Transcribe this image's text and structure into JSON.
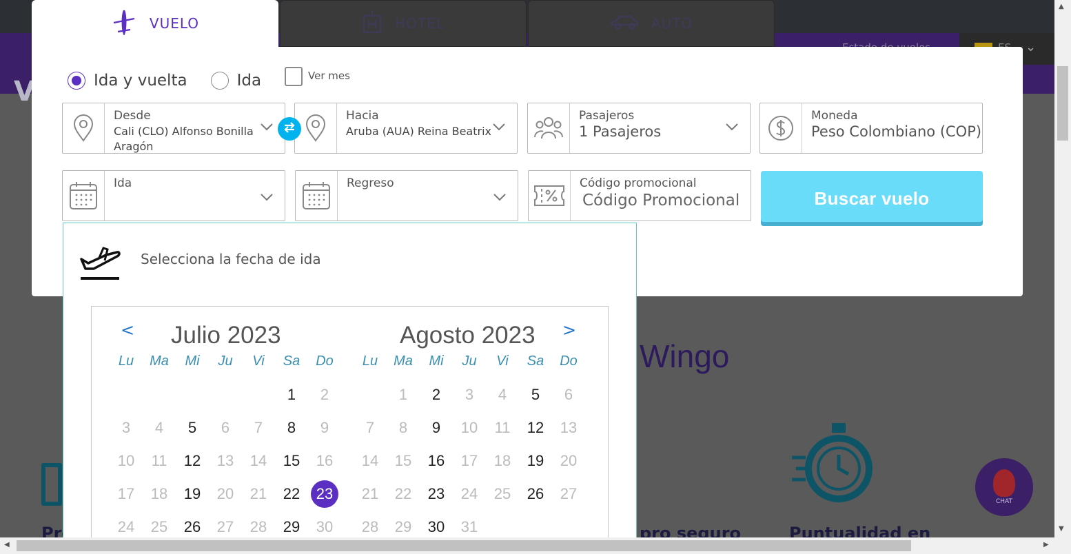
{
  "background": {
    "flight_status": "Estado de vuelos",
    "language": "ES",
    "brand_text": "Wingo",
    "logo_fragment": "V",
    "heading_left": "Pre",
    "heading_mid": "pro seguro",
    "heading_right": "Puntualidad en"
  },
  "tabs": [
    {
      "label": "VUELO",
      "icon": "plane-icon",
      "active": true
    },
    {
      "label": "HOTEL",
      "icon": "hotel-icon",
      "active": false
    },
    {
      "label": "AUTO",
      "icon": "car-icon",
      "active": false
    }
  ],
  "trip_type": {
    "round_trip": "Ida y vuelta",
    "one_way": "Ida",
    "selected": "round_trip",
    "view_month": "Ver mes"
  },
  "search": {
    "from_label": "Desde",
    "from_value_line1": "Cali (CLO) Alfonso Bonilla",
    "from_value_line2": "Aragón",
    "to_label": "Hacia",
    "to_value": "Aruba (AUA) Reina Beatrix",
    "passengers_label": "Pasajeros",
    "passengers_value": "1 Pasajeros",
    "currency_label": "Moneda",
    "currency_value": "Peso Colombiano (COP)",
    "depart_label": "Ida",
    "return_label": "Regreso",
    "promo_label": "Código promocional",
    "promo_placeholder": "Código Promocional",
    "search_button": "Buscar vuelo"
  },
  "datepicker": {
    "title": "Selecciona la fecha de ida",
    "prev": "<",
    "next": ">",
    "weekdays": [
      "Lu",
      "Ma",
      "Mi",
      "Ju",
      "Vi",
      "Sa",
      "Do"
    ],
    "selected_day": 23,
    "months": [
      {
        "title": "Julio 2023",
        "first_weekday_index": 5,
        "days": [
          1,
          2,
          3,
          4,
          5,
          6,
          7,
          8,
          9,
          10,
          11,
          12,
          13,
          14,
          15,
          16,
          17,
          18,
          19,
          20,
          21,
          22,
          23,
          24,
          25,
          26,
          27,
          28,
          29,
          30
        ],
        "available": [
          1,
          5,
          8,
          12,
          15,
          19,
          22,
          23,
          26,
          29
        ]
      },
      {
        "title": "Agosto 2023",
        "first_weekday_index": 1,
        "days": [
          1,
          2,
          3,
          4,
          5,
          6,
          7,
          8,
          9,
          10,
          11,
          12,
          13,
          14,
          15,
          16,
          17,
          18,
          19,
          20,
          21,
          22,
          23,
          24,
          25,
          26,
          27,
          28,
          29,
          30,
          31
        ],
        "available": [
          2,
          5,
          9,
          12,
          16,
          19,
          23,
          26,
          30
        ]
      }
    ]
  },
  "chat": {
    "label": "CHAT"
  },
  "colors": {
    "brand_purple": "#5a2fc2",
    "dark_purple": "#3b1f67",
    "cyan_button": "#68dcf9",
    "swap_blue": "#00b3ef",
    "weekday_blue": "#3a8fb0"
  }
}
